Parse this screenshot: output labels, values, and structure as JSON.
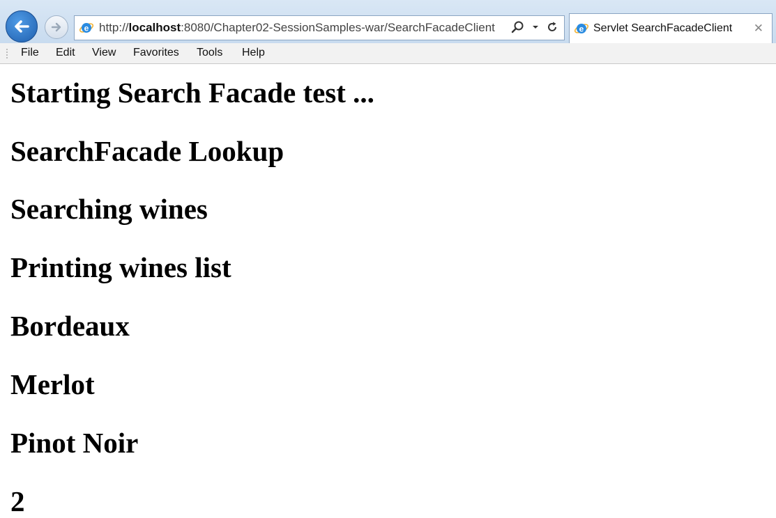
{
  "browser": {
    "address_bar": {
      "url_prefix": "http://",
      "url_host": "localhost",
      "url_rest": ":8080/Chapter02-SessionSamples-war/SearchFacadeClient"
    },
    "tab": {
      "title": "Servlet SearchFacadeClient"
    },
    "icons": {
      "back": "back-arrow-icon",
      "forward": "forward-arrow-icon",
      "page": "internet-explorer-icon",
      "search": "search-icon",
      "dropdown": "chevron-down-icon",
      "refresh": "refresh-icon",
      "close_tab": "close-icon"
    }
  },
  "menubar": {
    "items": [
      "File",
      "Edit",
      "View",
      "Favorites",
      "Tools",
      "Help"
    ]
  },
  "page": {
    "lines": [
      "Starting Search Facade test ...",
      "SearchFacade Lookup",
      "Searching wines",
      "Printing wines list",
      "Bordeaux",
      "Merlot",
      "Pinot Noir",
      "2"
    ]
  },
  "colors": {
    "chrome_background": "#d9e7f5",
    "back_button": "#2b6fc2",
    "ie_logo": "#2a8be0"
  }
}
